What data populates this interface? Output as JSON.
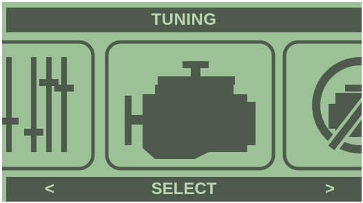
{
  "screen": {
    "title": "TUNING",
    "prev_label": "<",
    "select_label": "SELECT",
    "next_label": ">"
  },
  "menu_items": [
    {
      "icon": "sliders-icon"
    },
    {
      "icon": "engine-icon",
      "selected": true
    },
    {
      "icon": "engine-disabled-icon"
    }
  ],
  "colors": {
    "lcd_background": "#9dc196",
    "dark": "#4e5b4c",
    "light_text": "#b9d6b0"
  }
}
